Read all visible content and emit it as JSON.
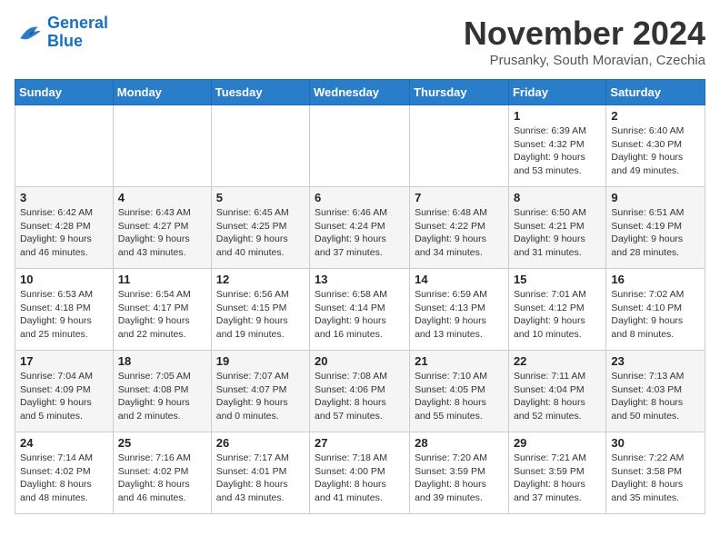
{
  "logo": {
    "line1": "General",
    "line2": "Blue"
  },
  "title": "November 2024",
  "subtitle": "Prusanky, South Moravian, Czechia",
  "days_of_week": [
    "Sunday",
    "Monday",
    "Tuesday",
    "Wednesday",
    "Thursday",
    "Friday",
    "Saturday"
  ],
  "weeks": [
    [
      {
        "day": "",
        "detail": ""
      },
      {
        "day": "",
        "detail": ""
      },
      {
        "day": "",
        "detail": ""
      },
      {
        "day": "",
        "detail": ""
      },
      {
        "day": "",
        "detail": ""
      },
      {
        "day": "1",
        "detail": "Sunrise: 6:39 AM\nSunset: 4:32 PM\nDaylight: 9 hours\nand 53 minutes."
      },
      {
        "day": "2",
        "detail": "Sunrise: 6:40 AM\nSunset: 4:30 PM\nDaylight: 9 hours\nand 49 minutes."
      }
    ],
    [
      {
        "day": "3",
        "detail": "Sunrise: 6:42 AM\nSunset: 4:28 PM\nDaylight: 9 hours\nand 46 minutes."
      },
      {
        "day": "4",
        "detail": "Sunrise: 6:43 AM\nSunset: 4:27 PM\nDaylight: 9 hours\nand 43 minutes."
      },
      {
        "day": "5",
        "detail": "Sunrise: 6:45 AM\nSunset: 4:25 PM\nDaylight: 9 hours\nand 40 minutes."
      },
      {
        "day": "6",
        "detail": "Sunrise: 6:46 AM\nSunset: 4:24 PM\nDaylight: 9 hours\nand 37 minutes."
      },
      {
        "day": "7",
        "detail": "Sunrise: 6:48 AM\nSunset: 4:22 PM\nDaylight: 9 hours\nand 34 minutes."
      },
      {
        "day": "8",
        "detail": "Sunrise: 6:50 AM\nSunset: 4:21 PM\nDaylight: 9 hours\nand 31 minutes."
      },
      {
        "day": "9",
        "detail": "Sunrise: 6:51 AM\nSunset: 4:19 PM\nDaylight: 9 hours\nand 28 minutes."
      }
    ],
    [
      {
        "day": "10",
        "detail": "Sunrise: 6:53 AM\nSunset: 4:18 PM\nDaylight: 9 hours\nand 25 minutes."
      },
      {
        "day": "11",
        "detail": "Sunrise: 6:54 AM\nSunset: 4:17 PM\nDaylight: 9 hours\nand 22 minutes."
      },
      {
        "day": "12",
        "detail": "Sunrise: 6:56 AM\nSunset: 4:15 PM\nDaylight: 9 hours\nand 19 minutes."
      },
      {
        "day": "13",
        "detail": "Sunrise: 6:58 AM\nSunset: 4:14 PM\nDaylight: 9 hours\nand 16 minutes."
      },
      {
        "day": "14",
        "detail": "Sunrise: 6:59 AM\nSunset: 4:13 PM\nDaylight: 9 hours\nand 13 minutes."
      },
      {
        "day": "15",
        "detail": "Sunrise: 7:01 AM\nSunset: 4:12 PM\nDaylight: 9 hours\nand 10 minutes."
      },
      {
        "day": "16",
        "detail": "Sunrise: 7:02 AM\nSunset: 4:10 PM\nDaylight: 9 hours\nand 8 minutes."
      }
    ],
    [
      {
        "day": "17",
        "detail": "Sunrise: 7:04 AM\nSunset: 4:09 PM\nDaylight: 9 hours\nand 5 minutes."
      },
      {
        "day": "18",
        "detail": "Sunrise: 7:05 AM\nSunset: 4:08 PM\nDaylight: 9 hours\nand 2 minutes."
      },
      {
        "day": "19",
        "detail": "Sunrise: 7:07 AM\nSunset: 4:07 PM\nDaylight: 9 hours\nand 0 minutes."
      },
      {
        "day": "20",
        "detail": "Sunrise: 7:08 AM\nSunset: 4:06 PM\nDaylight: 8 hours\nand 57 minutes."
      },
      {
        "day": "21",
        "detail": "Sunrise: 7:10 AM\nSunset: 4:05 PM\nDaylight: 8 hours\nand 55 minutes."
      },
      {
        "day": "22",
        "detail": "Sunrise: 7:11 AM\nSunset: 4:04 PM\nDaylight: 8 hours\nand 52 minutes."
      },
      {
        "day": "23",
        "detail": "Sunrise: 7:13 AM\nSunset: 4:03 PM\nDaylight: 8 hours\nand 50 minutes."
      }
    ],
    [
      {
        "day": "24",
        "detail": "Sunrise: 7:14 AM\nSunset: 4:02 PM\nDaylight: 8 hours\nand 48 minutes."
      },
      {
        "day": "25",
        "detail": "Sunrise: 7:16 AM\nSunset: 4:02 PM\nDaylight: 8 hours\nand 46 minutes."
      },
      {
        "day": "26",
        "detail": "Sunrise: 7:17 AM\nSunset: 4:01 PM\nDaylight: 8 hours\nand 43 minutes."
      },
      {
        "day": "27",
        "detail": "Sunrise: 7:18 AM\nSunset: 4:00 PM\nDaylight: 8 hours\nand 41 minutes."
      },
      {
        "day": "28",
        "detail": "Sunrise: 7:20 AM\nSunset: 3:59 PM\nDaylight: 8 hours\nand 39 minutes."
      },
      {
        "day": "29",
        "detail": "Sunrise: 7:21 AM\nSunset: 3:59 PM\nDaylight: 8 hours\nand 37 minutes."
      },
      {
        "day": "30",
        "detail": "Sunrise: 7:22 AM\nSunset: 3:58 PM\nDaylight: 8 hours\nand 35 minutes."
      }
    ]
  ]
}
